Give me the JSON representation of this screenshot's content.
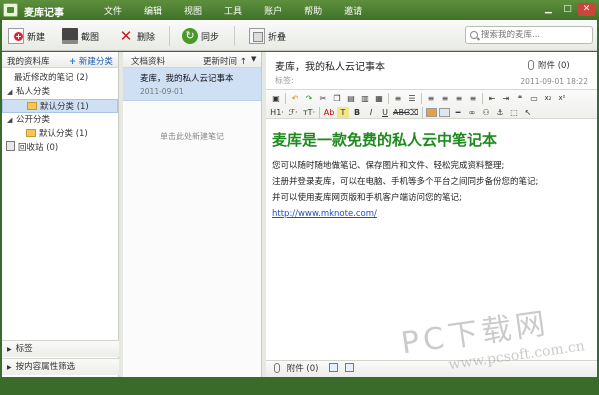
{
  "app": {
    "title": "麦库记事"
  },
  "menu": [
    "文件",
    "编辑",
    "视图",
    "工具",
    "账户",
    "帮助",
    "邀请"
  ],
  "toolbar": {
    "new_label": "新建",
    "screenshot_label": "截图",
    "delete_label": "删除",
    "sync_label": "同步",
    "fold_label": "折叠",
    "search_placeholder": "搜索我的麦库..."
  },
  "sidebar": {
    "header_title": "我的资料库",
    "new_category_label": "新建分类",
    "recent_label": "最近修改的笔记 (2)",
    "private_group": "私人分类",
    "private_default": "默认分类 (1)",
    "public_group": "公开分类",
    "public_default": "默认分类 (1)",
    "trash": "回收站 (0)",
    "footer_tags": "标签",
    "footer_filter": "按内容属性筛选"
  },
  "notes": {
    "header_title": "文档资料",
    "sort_label": "更新时间 ↑",
    "items": [
      {
        "title": "麦库，我的私人云记事本",
        "date": "2011-09-01"
      }
    ],
    "hint": "单击此处新建笔记"
  },
  "editor": {
    "title": "麦库，我的私人云记事本",
    "attachment_top": "附件 (0)",
    "tags_placeholder": "标签:",
    "date": "2011-09-01 18:22",
    "heading": "麦库是一款免费的私人云中笔记本",
    "paragraphs": [
      "您可以随时随地做笔记、保存图片和文件、轻松完成资料整理;",
      "注册并登录麦库，可以在电脑、手机等多个平台之间同步备份您的笔记;",
      "并可以使用麦库网页版和手机客户端访问您的笔记;"
    ],
    "link": "http://www.mknote.com/",
    "attachment_bottom": "附件 (0)"
  },
  "watermark": {
    "big": "PC下载网",
    "small": "www.pcsoft.com.cn"
  },
  "colors": {
    "frame": "#3b6b2a",
    "heading": "#1e8a1e",
    "selection": "#cfe0f5",
    "link": "#1f4fc4"
  }
}
